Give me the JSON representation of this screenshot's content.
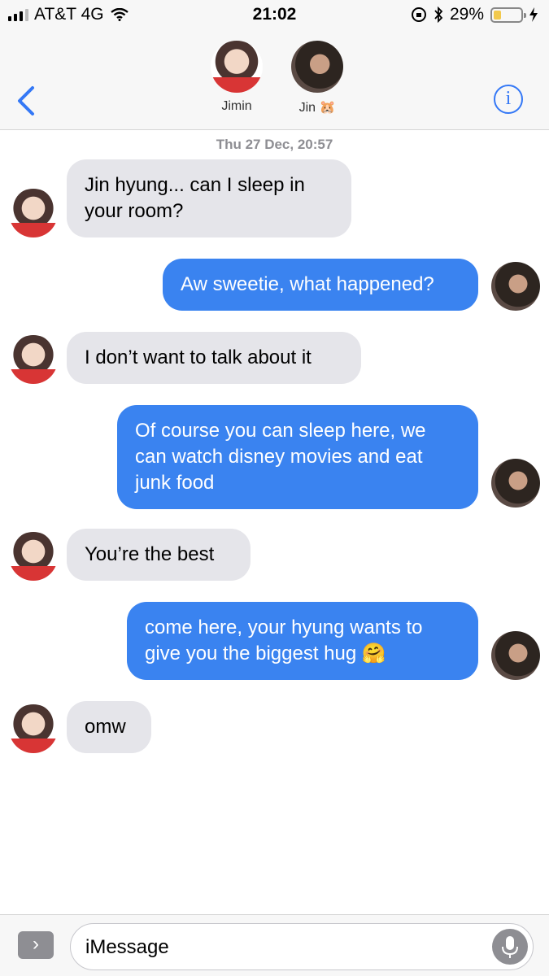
{
  "status_bar": {
    "carrier": "AT&T 4G",
    "time": "21:02",
    "battery": "29%",
    "battery_level": 0.29
  },
  "header": {
    "contacts": [
      {
        "name": "Jimin"
      },
      {
        "name": "Jin 🐹"
      }
    ],
    "info_label": "i"
  },
  "conversation": {
    "timestamp": "Thu 27 Dec, 20:57",
    "messages": [
      {
        "sender": "Jimin",
        "text": "Jin hyung... can I sleep in your room?"
      },
      {
        "sender": "Jin",
        "text": "Aw sweetie, what happened?"
      },
      {
        "sender": "Jimin",
        "text": "I don’t want to talk about it"
      },
      {
        "sender": "Jin",
        "text": "Of course you can sleep here, we can watch disney movies and eat junk food"
      },
      {
        "sender": "Jimin",
        "text": "You’re the best"
      },
      {
        "sender": "Jin",
        "text": "come here, your hyung wants to give you the biggest hug 🤗"
      },
      {
        "sender": "Jimin",
        "text": "omw"
      }
    ]
  },
  "input": {
    "placeholder": "iMessage",
    "apps_label": "›"
  },
  "colors": {
    "outgoing_bubble": "#3a83f0",
    "incoming_bubble": "#e5e5ea",
    "accent": "#3478f6"
  },
  "icons": [
    "signal-icon",
    "wifi-icon",
    "orientation-lock-icon",
    "bluetooth-icon",
    "battery-icon",
    "charging-icon",
    "back-chevron-icon",
    "info-icon",
    "apps-icon",
    "microphone-icon"
  ]
}
